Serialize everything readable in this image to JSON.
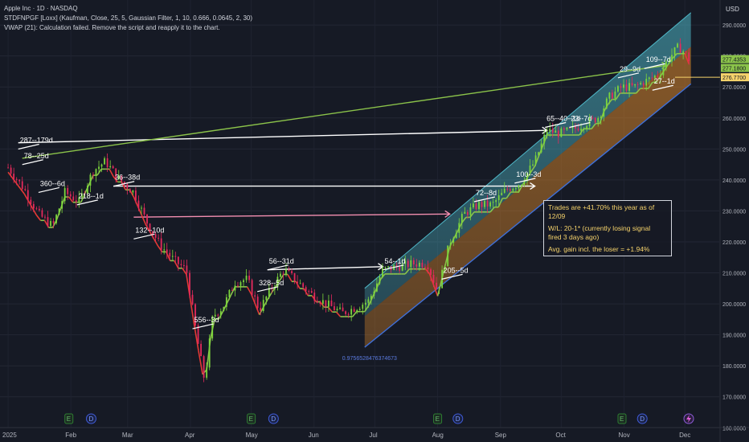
{
  "legend": {
    "line1": "Apple Inc · 1D · NASDAQ",
    "line2": "STDFNPGF [Loxx] (Kaufman, Close, 25, 5, Gaussian Filter, 1, 10, 0.666, 0.0645, 2, 30)",
    "line3": "VWAP (21): Calculation failed. Remove the script and reapply it to the chart."
  },
  "currency": "USD",
  "info_box": {
    "line1": "Trades are +41.70% this year as of 12/09",
    "line2a": "W/L: 20-1* (currently losing signal",
    "line2b": "fired 3 days ago)",
    "line3": "Avg. gain incl. the loser = +1.94%"
  },
  "channel_low_label": "0.9756528476374673",
  "colors": {
    "background": "#161a25",
    "bull_candle": "#7cd63c",
    "bear_candle": "#e5295c",
    "filter_green": "#8bc34a",
    "filter_red": "#e53935",
    "channel_fill_top": "#4fb8c8",
    "channel_fill_bottom": "#e08a2a",
    "arrow_white": "#ffffff",
    "arrow_pink": "#f48fb1",
    "price_tag_green": "#8bc34a",
    "price_tag_yellow": "#f6d36b"
  },
  "chart_data": {
    "type": "candlestick",
    "title": "Apple Inc · 1D · NASDAQ",
    "ylabel": "USD",
    "ylim": [
      158,
      296
    ],
    "y_ticks": [
      "290.0000",
      "280.0000",
      "270.0000",
      "260.0000",
      "250.0000",
      "240.0000",
      "230.0000",
      "220.0000",
      "210.0000",
      "200.0000",
      "190.0000",
      "180.0000",
      "170.0000",
      "160.0000"
    ],
    "y_tick_values": [
      290,
      280,
      270,
      260,
      250,
      240,
      230,
      220,
      210,
      200,
      190,
      180,
      170,
      160
    ],
    "x_ticks": [
      "2025",
      "Feb",
      "Mar",
      "Apr",
      "May",
      "Jun",
      "Jul",
      "Aug",
      "Sep",
      "Oct",
      "Nov",
      "Dec"
    ],
    "x_tick_days": [
      0,
      31,
      59,
      90,
      120,
      151,
      181,
      212,
      243,
      273,
      304,
      334
    ],
    "price_path": [
      [
        0,
        244
      ],
      [
        8,
        237
      ],
      [
        15,
        229
      ],
      [
        22,
        225
      ],
      [
        28,
        236
      ],
      [
        35,
        233
      ],
      [
        42,
        243
      ],
      [
        48,
        246
      ],
      [
        55,
        240
      ],
      [
        62,
        236
      ],
      [
        68,
        227
      ],
      [
        75,
        219
      ],
      [
        82,
        214
      ],
      [
        88,
        211
      ],
      [
        93,
        190
      ],
      [
        97,
        175
      ],
      [
        101,
        196
      ],
      [
        106,
        199
      ],
      [
        112,
        207
      ],
      [
        118,
        208
      ],
      [
        124,
        198
      ],
      [
        129,
        204
      ],
      [
        136,
        211
      ],
      [
        143,
        207
      ],
      [
        150,
        203
      ],
      [
        157,
        200
      ],
      [
        165,
        197
      ],
      [
        172,
        199
      ],
      [
        178,
        201
      ],
      [
        185,
        211
      ],
      [
        192,
        212
      ],
      [
        200,
        213
      ],
      [
        207,
        213
      ],
      [
        212,
        204
      ],
      [
        218,
        220
      ],
      [
        225,
        229
      ],
      [
        232,
        232
      ],
      [
        239,
        232
      ],
      [
        246,
        237
      ],
      [
        253,
        239
      ],
      [
        260,
        246
      ],
      [
        266,
        256
      ],
      [
        272,
        255
      ],
      [
        278,
        256
      ],
      [
        284,
        258
      ],
      [
        291,
        260
      ],
      [
        297,
        267
      ],
      [
        303,
        270
      ],
      [
        309,
        270
      ],
      [
        315,
        272
      ],
      [
        321,
        274
      ],
      [
        327,
        280
      ],
      [
        331,
        283
      ],
      [
        334,
        281
      ],
      [
        337,
        278
      ]
    ],
    "channel": {
      "start_day": 176,
      "end_day": 337,
      "upper": [
        205,
        294
      ],
      "mid": [
        196,
        283
      ],
      "lower": [
        186,
        271
      ]
    },
    "price_labels": [
      {
        "text": "277.4353",
        "value": 277.4353,
        "color": "#8bc34a"
      },
      {
        "text": "277.1800",
        "value": 277.18,
        "color": "#8bc34a"
      },
      {
        "text": "276.7700",
        "value": 276.77,
        "color": "#f6d36b"
      }
    ],
    "trades": [
      {
        "label": "287--179d",
        "day": 5,
        "y": 251,
        "color": "#ffffff"
      },
      {
        "label": "78--25d",
        "day": 7,
        "y": 246,
        "color": "#ffffff"
      },
      {
        "label": "360--6d",
        "day": 15,
        "y": 237,
        "color": "#ffffff"
      },
      {
        "label": "218--1d",
        "day": 34,
        "y": 233,
        "color": "#ffffff"
      },
      {
        "label": "36--38d",
        "day": 52,
        "y": 239,
        "color": "#ffffff"
      },
      {
        "label": "132--10d",
        "day": 62,
        "y": 222,
        "color": "#ffffff"
      },
      {
        "label": "556--3d",
        "day": 91,
        "y": 193,
        "color": "#ffffff"
      },
      {
        "label": "56--31d",
        "day": 128,
        "y": 212,
        "color": "#ffffff"
      },
      {
        "label": "328--5d",
        "day": 123,
        "y": 205,
        "color": "#ffffff"
      },
      {
        "label": "54--1d",
        "day": 185,
        "y": 212,
        "color": "#ffffff"
      },
      {
        "label": "205--5d",
        "day": 214,
        "y": 209,
        "color": "#ffffff"
      },
      {
        "label": "72--8d",
        "day": 230,
        "y": 234,
        "color": "#ffffff"
      },
      {
        "label": "100--3d",
        "day": 250,
        "y": 240,
        "color": "#ffffff"
      },
      {
        "label": "65--40--1d",
        "day": 265,
        "y": 258,
        "color": "#ffffff"
      },
      {
        "label": "23--7d",
        "day": 277,
        "y": 258,
        "color": "#ffffff"
      },
      {
        "label": "29--9d",
        "day": 301,
        "y": 274,
        "color": "#ffffff"
      },
      {
        "label": "109--7d",
        "day": 314,
        "y": 277,
        "color": "#ffffff"
      },
      {
        "label": "27--1d",
        "day": 318,
        "y": 270,
        "color": "#ffffff"
      }
    ],
    "long_lines": [
      {
        "from_day": 5,
        "from_y": 252,
        "to_day": 266,
        "to_y": 256,
        "color": "#ffffff"
      },
      {
        "from_day": 7,
        "from_y": 247,
        "to_day": 325,
        "to_y": 277,
        "color": "#8bc34a"
      },
      {
        "from_day": 52,
        "from_y": 238,
        "to_day": 260,
        "to_y": 238,
        "color": "#ffffff"
      },
      {
        "from_day": 62,
        "from_y": 228,
        "to_day": 218,
        "to_y": 229,
        "color": "#f48fb1"
      },
      {
        "from_day": 128,
        "from_y": 211,
        "to_day": 185,
        "to_y": 212,
        "color": "#ffffff"
      }
    ],
    "events": [
      {
        "label": "E",
        "day": 30,
        "type": "earnings"
      },
      {
        "label": "D",
        "day": 41,
        "type": "dividend"
      },
      {
        "label": "E",
        "day": 120,
        "type": "earnings"
      },
      {
        "label": "D",
        "day": 131,
        "type": "dividend"
      },
      {
        "label": "E",
        "day": 212,
        "type": "earnings"
      },
      {
        "label": "D",
        "day": 222,
        "type": "dividend"
      },
      {
        "label": "E",
        "day": 303,
        "type": "earnings"
      },
      {
        "label": "D",
        "day": 313,
        "type": "dividend"
      }
    ]
  }
}
